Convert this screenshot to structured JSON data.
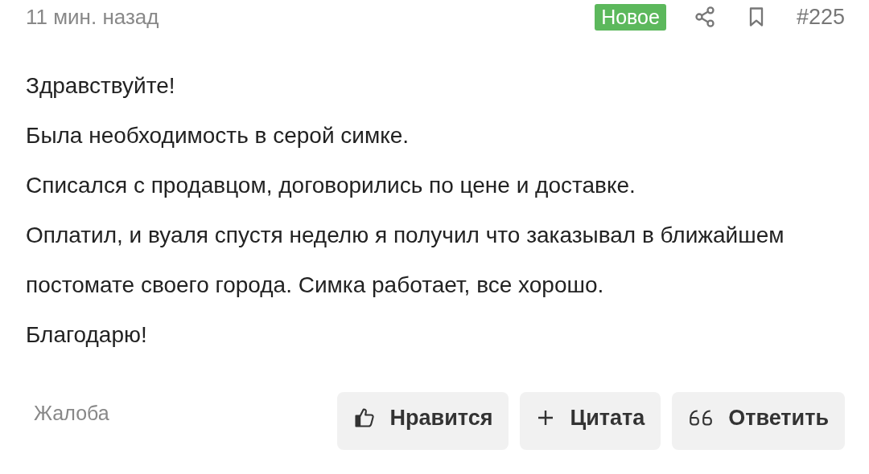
{
  "post": {
    "time": "11 мин. назад",
    "badge": "Новое",
    "number": "#225"
  },
  "paragraphs": [
    "Здравствуйте!",
    "Была необходимость в серой симке.",
    "Списался с продавцом, договорились по цене и доставке.",
    "Оплатил, и вуаля спустя неделю я получил что заказывал в ближайшем постомате своего города. Симка работает, все хорошо.",
    "Благодарю!"
  ],
  "report": "Жалоба",
  "actions": [
    {
      "kind": "like",
      "label": "Нравится"
    },
    {
      "kind": "quote",
      "label": "Цитата"
    },
    {
      "kind": "reply",
      "label": "Ответить"
    }
  ]
}
